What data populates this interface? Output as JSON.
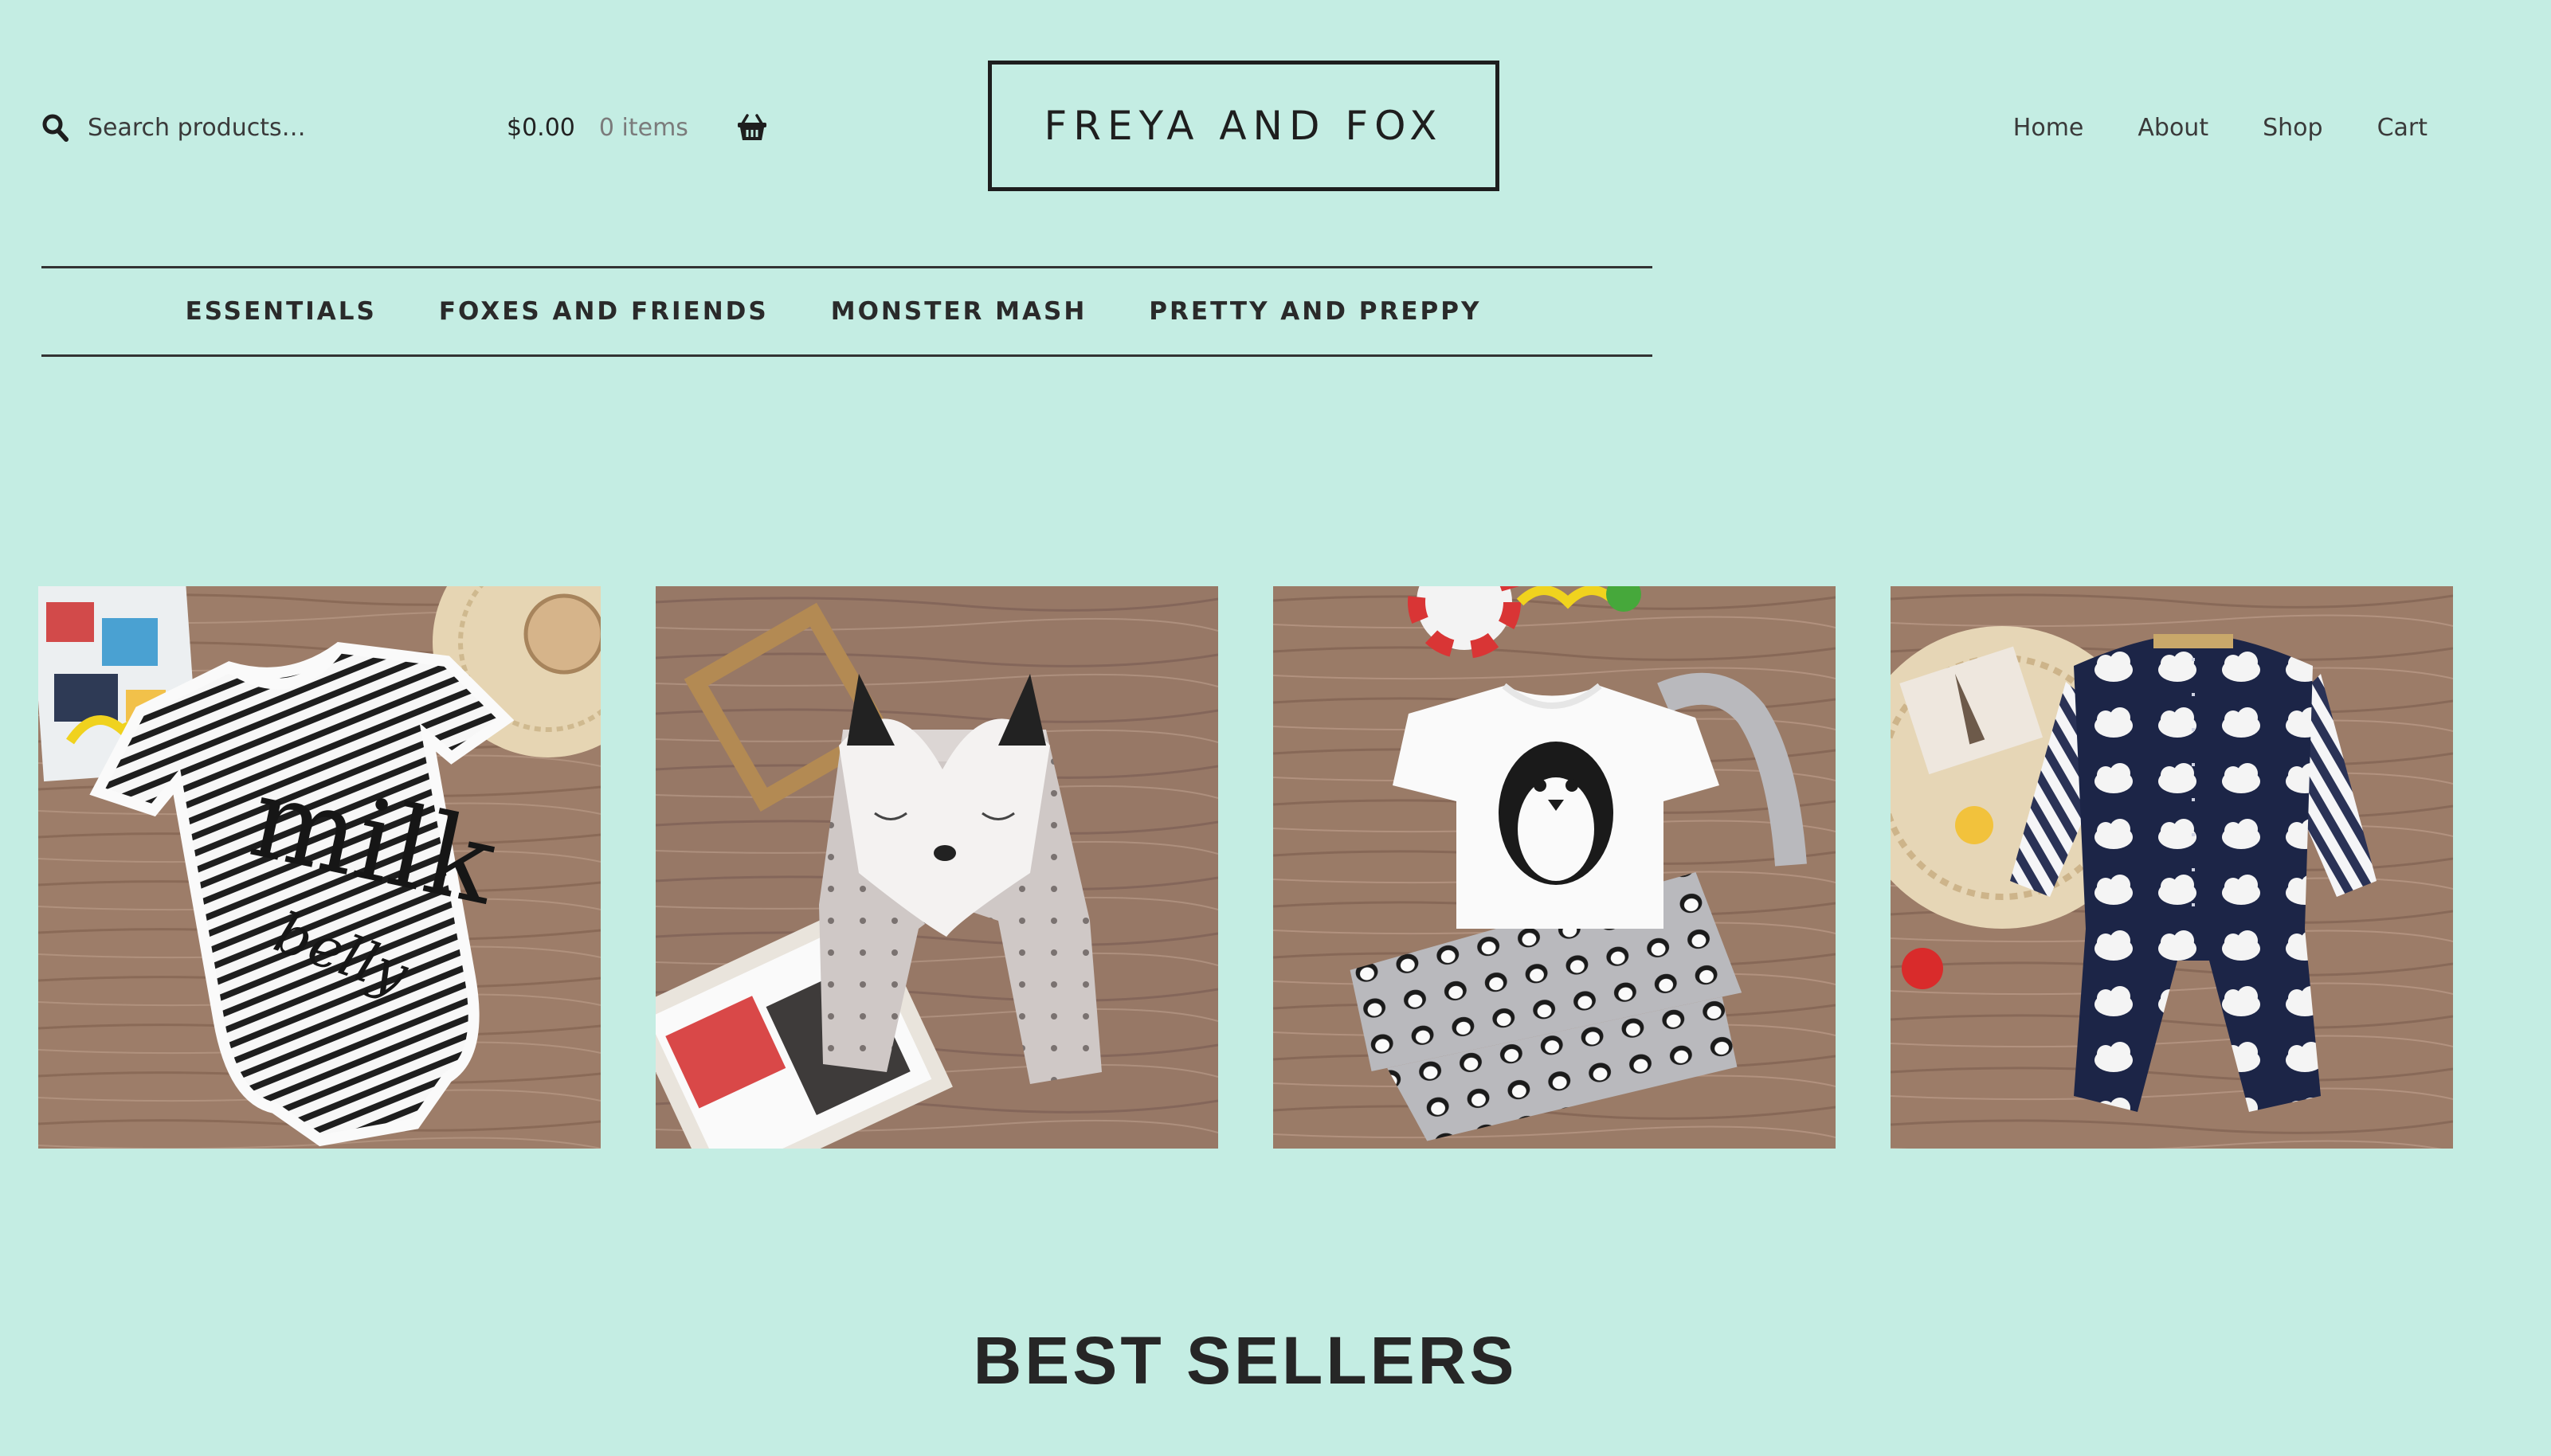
{
  "header": {
    "search": {
      "placeholder": "Search products…"
    },
    "cart": {
      "amount": "$0.00",
      "items": "0 items"
    },
    "logo": "FREYA AND FOX",
    "nav": [
      "Home",
      "About",
      "Shop",
      "Cart"
    ]
  },
  "categories": [
    "ESSENTIALS",
    "FOXES AND FRIENDS",
    "MONSTER MASH",
    "PRETTY AND PREPPY"
  ],
  "products": [
    {
      "icon": "striped-bodysuit-milk-belly-image",
      "print_line1": "milk",
      "print_line2": "belly"
    },
    {
      "icon": "fox-pants-image"
    },
    {
      "icon": "penguin-tee-set-image"
    },
    {
      "icon": "cloud-romper-image"
    }
  ],
  "sections": {
    "best_sellers": "BEST SELLERS"
  },
  "colors": {
    "background": "#c4ede3",
    "text": "#2b2b2b",
    "wood": "#9a7a66"
  }
}
